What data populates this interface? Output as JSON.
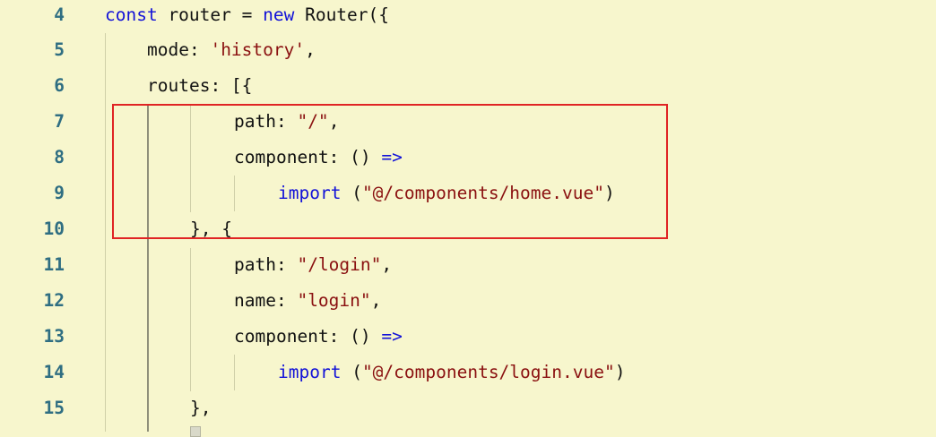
{
  "editor": {
    "lines": [
      {
        "number": "4",
        "tokens": [
          {
            "t": "const",
            "c": "kw"
          },
          {
            "t": " router = ",
            "c": "plain"
          },
          {
            "t": "new",
            "c": "kw"
          },
          {
            "t": " Router({",
            "c": "plain"
          }
        ]
      },
      {
        "number": "5",
        "tokens": [
          {
            "t": "mode: ",
            "c": "plain"
          },
          {
            "t": "'history'",
            "c": "str"
          },
          {
            "t": ",",
            "c": "plain"
          }
        ]
      },
      {
        "number": "6",
        "tokens": [
          {
            "t": "routes: [{",
            "c": "plain"
          }
        ]
      },
      {
        "number": "7",
        "tokens": [
          {
            "t": "path: ",
            "c": "plain"
          },
          {
            "t": "\"/\"",
            "c": "str"
          },
          {
            "t": ",",
            "c": "plain"
          }
        ]
      },
      {
        "number": "8",
        "tokens": [
          {
            "t": "component: () ",
            "c": "plain"
          },
          {
            "t": "=>",
            "c": "kw"
          }
        ]
      },
      {
        "number": "9",
        "tokens": [
          {
            "t": "import",
            "c": "kw"
          },
          {
            "t": " (",
            "c": "plain"
          },
          {
            "t": "\"@/components/home.vue\"",
            "c": "str"
          },
          {
            "t": ")",
            "c": "plain"
          }
        ]
      },
      {
        "number": "10",
        "tokens": [
          {
            "t": "}, {",
            "c": "plain"
          }
        ]
      },
      {
        "number": "11",
        "tokens": [
          {
            "t": "path: ",
            "c": "plain"
          },
          {
            "t": "\"/login\"",
            "c": "str"
          },
          {
            "t": ",",
            "c": "plain"
          }
        ]
      },
      {
        "number": "12",
        "tokens": [
          {
            "t": "name: ",
            "c": "plain"
          },
          {
            "t": "\"login\"",
            "c": "str"
          },
          {
            "t": ",",
            "c": "plain"
          }
        ]
      },
      {
        "number": "13",
        "tokens": [
          {
            "t": "component: () ",
            "c": "plain"
          },
          {
            "t": "=>",
            "c": "kw"
          }
        ]
      },
      {
        "number": "14",
        "tokens": [
          {
            "t": "import",
            "c": "kw"
          },
          {
            "t": " (",
            "c": "plain"
          },
          {
            "t": "\"@/components/login.vue\"",
            "c": "str"
          },
          {
            "t": ")",
            "c": "plain"
          }
        ]
      },
      {
        "number": "15",
        "tokens": [
          {
            "t": "},",
            "c": "plain"
          }
        ]
      }
    ]
  },
  "colors": {
    "background": "#f7f6cd",
    "line_number": "#2f6e82",
    "keyword": "#1212d8",
    "string": "#8a1010",
    "highlight_border": "#e02424"
  }
}
